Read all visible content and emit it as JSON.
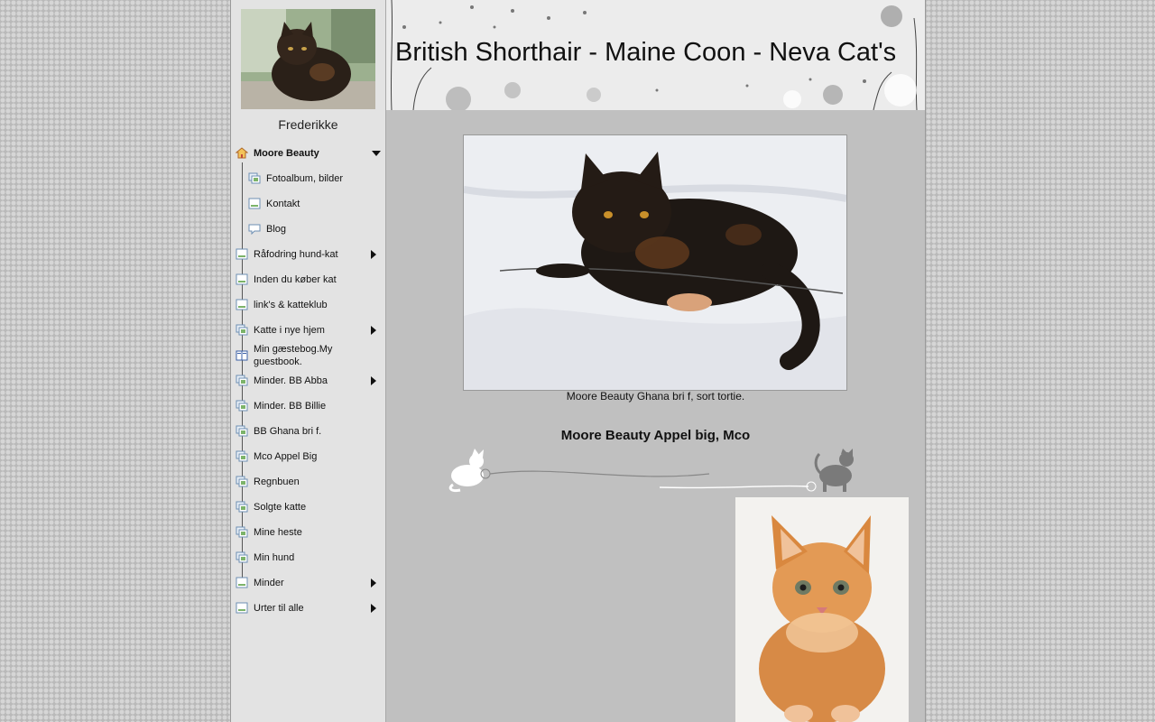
{
  "header": {
    "title": "British Shorthair - Maine Coon - Neva Cat's"
  },
  "sidebar": {
    "profile_name": "Frederikke",
    "items": [
      {
        "label": "Moore Beauty",
        "bold": true,
        "expanded": true,
        "icon": "home-icon"
      },
      {
        "label": "Fotoalbum, bilder",
        "sub": true,
        "icon": "album-icon"
      },
      {
        "label": "Kontakt",
        "sub": true,
        "icon": "page-icon"
      },
      {
        "label": "Blog",
        "sub": true,
        "icon": "blog-icon"
      },
      {
        "label": "Råfodring hund-kat",
        "arrow": true,
        "icon": "page-icon"
      },
      {
        "label": "Inden du køber kat",
        "icon": "page-icon"
      },
      {
        "label": "link's & katteklub",
        "icon": "page-icon"
      },
      {
        "label": "Katte i nye hjem",
        "arrow": true,
        "icon": "album-icon"
      },
      {
        "label": "Min gæstebog.My guestbook.",
        "icon": "guestbook-icon"
      },
      {
        "label": "Minder. BB Abba",
        "arrow": true,
        "icon": "album-icon"
      },
      {
        "label": "Minder. BB Billie",
        "icon": "album-icon"
      },
      {
        "label": "BB Ghana bri f.",
        "icon": "album-icon"
      },
      {
        "label": "Mco Appel Big",
        "icon": "album-icon"
      },
      {
        "label": "Regnbuen",
        "icon": "album-icon"
      },
      {
        "label": "Solgte katte",
        "icon": "album-icon"
      },
      {
        "label": "Mine heste",
        "icon": "album-icon"
      },
      {
        "label": "Min hund",
        "icon": "album-icon"
      },
      {
        "label": "Minder",
        "arrow": true,
        "icon": "page-icon"
      },
      {
        "label": "Urter til alle",
        "arrow": true,
        "icon": "page-icon"
      }
    ]
  },
  "main": {
    "caption": "Moore Beauty Ghana bri f, sort tortie.",
    "subheading": "Moore Beauty Appel big, Mco"
  }
}
